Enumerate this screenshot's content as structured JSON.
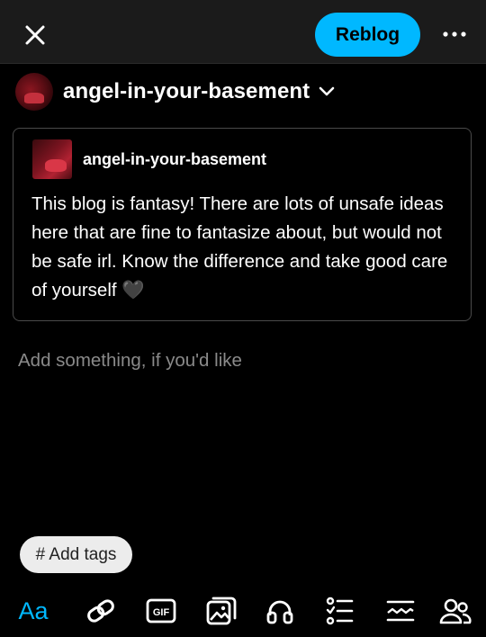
{
  "header": {
    "close_icon": "close-icon",
    "reblog_label": "Reblog",
    "more_icon": "more-horizontal-icon",
    "accent_color": "#00b8ff"
  },
  "blog_selector": {
    "blog_name": "angel-in-your-basement",
    "chevron_icon": "chevron-down-icon"
  },
  "post": {
    "blog_name": "angel-in-your-basement",
    "text": "This blog is fantasy! There are lots of unsafe ideas here that are fine to fantasize about, but would not be safe irl. Know the difference and take good care of yourself 🖤"
  },
  "composer": {
    "placeholder": "Add something, if you'd like"
  },
  "tags": {
    "label": "# Add tags"
  },
  "toolbar": {
    "text_label": "Aa",
    "items": [
      "text-format-icon",
      "link-icon",
      "gif-icon",
      "image-icon",
      "audio-icon",
      "list-icon",
      "divider-icon",
      "mention-icon"
    ]
  }
}
